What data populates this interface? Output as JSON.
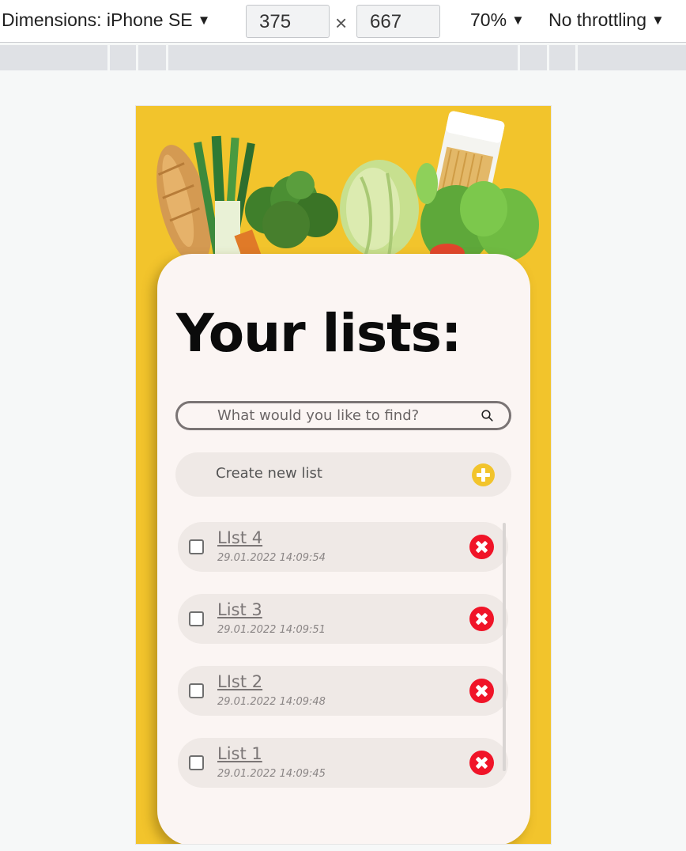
{
  "devtools": {
    "dimensions_label": "Dimensions: iPhone SE",
    "width_value": "375",
    "times_sign": "×",
    "height_value": "667",
    "zoom_label": "70%",
    "throttle_label": "No throttling",
    "caret": "▼"
  },
  "app": {
    "title": "Your lists:",
    "search": {
      "placeholder": "What would you like to find?"
    },
    "create_label": "Create new list",
    "lists": [
      {
        "name": "LIst 4",
        "date": "29.01.2022 14:09:54"
      },
      {
        "name": "List 3",
        "date": "29.01.2022 14:09:51"
      },
      {
        "name": "LIst 2",
        "date": "29.01.2022 14:09:48"
      },
      {
        "name": "List 1",
        "date": "29.01.2022 14:09:45"
      }
    ]
  },
  "colors": {
    "background_yellow": "#f2c42c",
    "card": "#fbf5f3",
    "delete_red": "#f01428",
    "accent_plus": "#f2c42c"
  },
  "icons": [
    "search-icon",
    "plus-icon",
    "delete-icon"
  ]
}
